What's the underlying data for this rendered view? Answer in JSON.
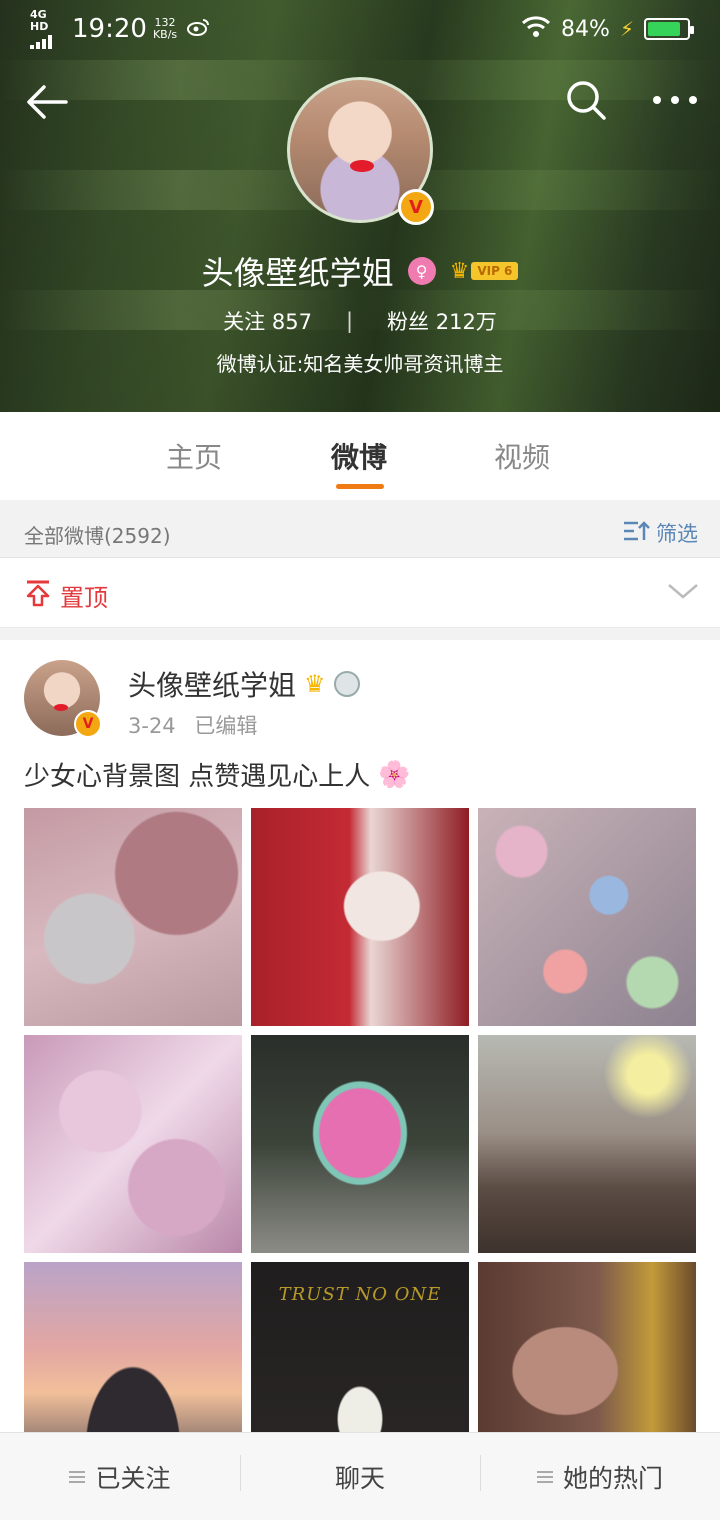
{
  "status_bar": {
    "network": "4G HD",
    "time": "19:20",
    "speed_value": "132",
    "speed_unit": "KB/s",
    "battery_pct": "84%",
    "battery_level": 0.84,
    "icons": [
      "signal-icon",
      "weibo-logo-icon",
      "wifi-icon",
      "charging-icon",
      "battery-icon"
    ]
  },
  "header": {
    "actions": [
      "back-arrow-icon",
      "search-icon",
      "more-icon"
    ],
    "name": "头像壁纸学姐",
    "vip_level": "VIP 6",
    "following_label": "关注",
    "following_count": "857",
    "fans_label": "粉丝",
    "fans_count": "212万",
    "verification": "微博认证:知名美女帅哥资讯博主"
  },
  "tabs": [
    {
      "label": "主页",
      "active": false
    },
    {
      "label": "微博",
      "active": true
    },
    {
      "label": "视频",
      "active": false
    }
  ],
  "filter_bar": {
    "count_text": "全部微博(2592)",
    "filter_label": "筛选"
  },
  "pinned": {
    "label": "置顶"
  },
  "post": {
    "author": "头像壁纸学姐",
    "date": "3-24",
    "edited": "已编辑",
    "text": "少女心背景图 点赞遇见心上人",
    "emoji": "🌸",
    "images": [
      {
        "name": "photo-pink-hairties",
        "caption": ""
      },
      {
        "name": "photo-red-dress",
        "caption": ""
      },
      {
        "name": "photo-heart-gems",
        "caption": ""
      },
      {
        "name": "photo-pink-hearts",
        "caption": ""
      },
      {
        "name": "photo-heart-mirror",
        "caption": ""
      },
      {
        "name": "photo-window-sunset",
        "caption": ""
      },
      {
        "name": "photo-sunset-girl",
        "caption": ""
      },
      {
        "name": "photo-trust-no-one",
        "caption": "TRUST NO ONE"
      },
      {
        "name": "photo-gold-frame",
        "caption": ""
      }
    ]
  },
  "bottom_bar": {
    "followed": "已关注",
    "chat": "聊天",
    "hot": "她的热门"
  },
  "colors": {
    "accent_orange": "#f07b12",
    "pinned_red": "#e4393c",
    "filter_blue": "#5b87b6",
    "vip_gold": "#f5b500"
  }
}
